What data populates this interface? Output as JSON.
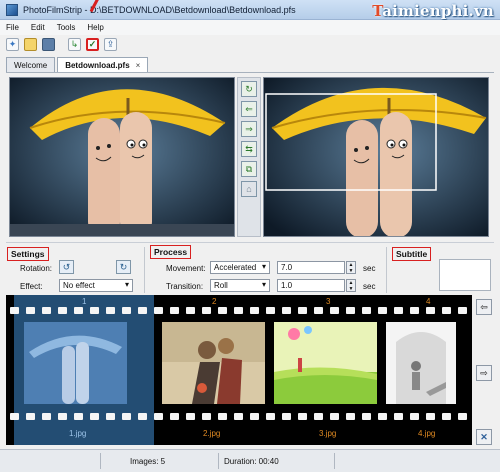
{
  "window": {
    "title": "PhotoFilmStrip - D:\\BETDOWNLOAD\\Betdownload\\Betdownload.pfs",
    "watermark": "Taimienphi.vn"
  },
  "menu": {
    "items": [
      "File",
      "Edit",
      "Tools",
      "Help"
    ]
  },
  "toolbar": {
    "buttons": [
      {
        "icon": "new-project-icon",
        "glyph": "✦"
      },
      {
        "icon": "open-folder-icon",
        "glyph": "📂"
      },
      {
        "icon": "save-icon",
        "glyph": "▣"
      },
      {
        "icon": "import-pictures-icon",
        "glyph": "↳"
      },
      {
        "icon": "render-check-icon",
        "glyph": "✓"
      },
      {
        "icon": "export-icon",
        "glyph": "⇪"
      }
    ],
    "highlight_color": "#d82020"
  },
  "tabs": [
    {
      "label": "Welcome",
      "selected": false
    },
    {
      "label": "Betdownload.pfs",
      "selected": true,
      "close": "×"
    }
  ],
  "editor": {
    "side_buttons": [
      "image-rotate-icon",
      "move-to-start-icon",
      "move-to-end-icon",
      "swap-icon",
      "link-icon",
      "lock-icon"
    ]
  },
  "settings": {
    "title": "Settings",
    "rotation_label": "Rotation:",
    "effect_label": "Effect:",
    "effect_value": "No effect"
  },
  "process": {
    "title": "Process",
    "movement_label": "Movement:",
    "movement_value": "Accelerated",
    "movement_duration": "7.0",
    "movement_unit": "sec",
    "transition_label": "Transition:",
    "transition_value": "Roll",
    "transition_duration": "1.0",
    "transition_unit": "sec"
  },
  "subtitle": {
    "title": "Subtitle"
  },
  "filmstrip": {
    "frames": [
      {
        "number": "1",
        "name": "1.jpg",
        "selected": true
      },
      {
        "number": "2",
        "name": "2.jpg",
        "selected": false
      },
      {
        "number": "3",
        "name": "3.jpg",
        "selected": false
      },
      {
        "number": "4",
        "name": "4.jpg",
        "selected": false
      }
    ],
    "number_color": "#e08a22"
  },
  "nav": {
    "buttons": [
      "move-left-icon",
      "move-right-icon",
      "remove-icon"
    ]
  },
  "status": {
    "images": "Images: 5",
    "duration": "Duration: 00:40"
  },
  "colors": {
    "accent": "#d82020",
    "selection": "#3f8cd2"
  }
}
